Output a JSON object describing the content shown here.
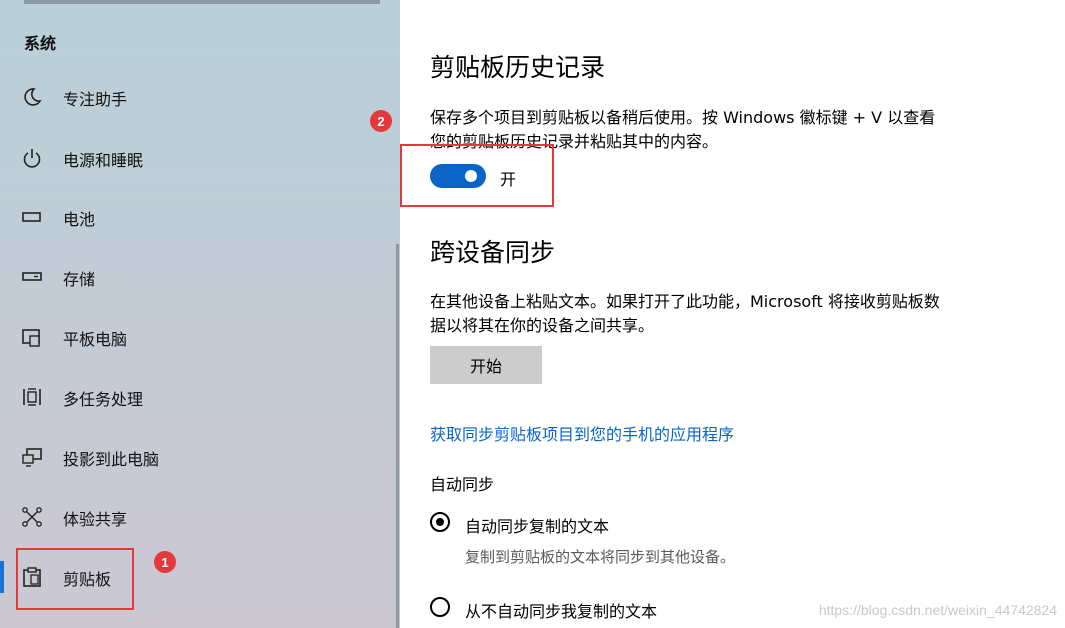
{
  "sidebar": {
    "heading": "系统",
    "items": [
      {
        "label": "专注助手",
        "icon": "moon-icon"
      },
      {
        "label": "电源和睡眠",
        "icon": "power-icon"
      },
      {
        "label": "电池",
        "icon": "battery-icon"
      },
      {
        "label": "存储",
        "icon": "storage-icon"
      },
      {
        "label": "平板电脑",
        "icon": "tablet-icon"
      },
      {
        "label": "多任务处理",
        "icon": "multitasking-icon"
      },
      {
        "label": "投影到此电脑",
        "icon": "project-icon"
      },
      {
        "label": "体验共享",
        "icon": "shared-experiences-icon"
      },
      {
        "label": "剪贴板",
        "icon": "clipboard-icon",
        "selected": true
      }
    ]
  },
  "annotations": {
    "badge1": "1",
    "badge2": "2",
    "color": "#e4393c"
  },
  "main": {
    "history": {
      "title": "剪贴板历史记录",
      "desc_line1": "保存多个项目到剪贴板以备稍后使用。按 Windows 徽标键 + V 以查看",
      "desc_line2": "您的剪贴板历史记录并粘贴其中的内容。",
      "toggle_state": "开",
      "toggle_on": true
    },
    "sync": {
      "title": "跨设备同步",
      "desc_line1": "在其他设备上粘贴文本。如果打开了此功能，Microsoft 将接收剪贴板数",
      "desc_line2": "据以将其在你的设备之间共享。",
      "start_button": "开始",
      "link": "获取同步剪贴板项目到您的手机的应用程序",
      "auto_sync_label": "自动同步",
      "options": [
        {
          "label": "自动同步复制的文本",
          "desc": "复制到剪贴板的文本将同步到其他设备。",
          "selected": true
        },
        {
          "label": "从不自动同步我复制的文本",
          "selected": false
        }
      ]
    }
  },
  "colors": {
    "accent": "#0a64c8",
    "annotation": "#e4393c"
  },
  "watermark": "https://blog.csdn.net/weixin_44742824"
}
